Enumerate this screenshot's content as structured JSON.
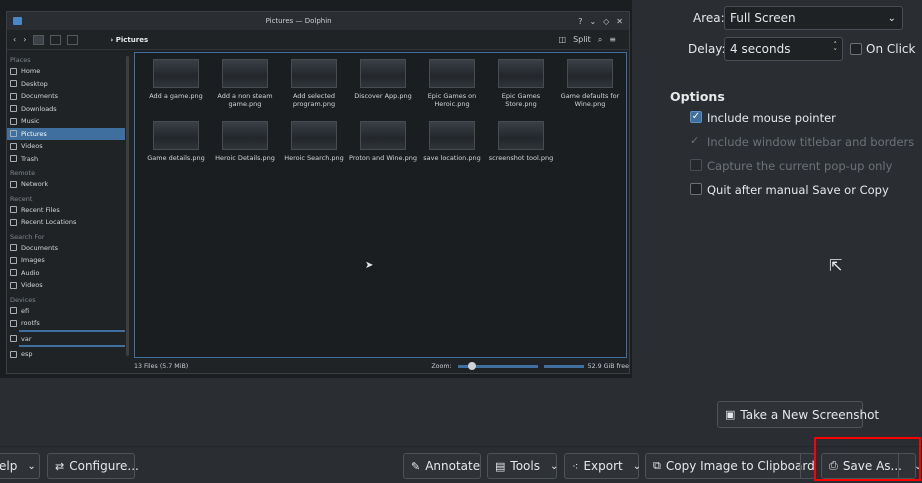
{
  "preview": {
    "dolphin": {
      "title": "Pictures — Dolphin",
      "breadcrumb": "Pictures",
      "split_label": "Split",
      "sidebar": [
        {
          "type": "section",
          "label": "Places"
        },
        {
          "type": "item",
          "label": "Home"
        },
        {
          "type": "item",
          "label": "Desktop"
        },
        {
          "type": "item",
          "label": "Documents"
        },
        {
          "type": "item",
          "label": "Downloads"
        },
        {
          "type": "item",
          "label": "Music"
        },
        {
          "type": "item",
          "label": "Pictures",
          "selected": true
        },
        {
          "type": "item",
          "label": "Videos"
        },
        {
          "type": "item",
          "label": "Trash"
        },
        {
          "type": "section",
          "label": "Remote"
        },
        {
          "type": "item",
          "label": "Network"
        },
        {
          "type": "section",
          "label": "Recent"
        },
        {
          "type": "item",
          "label": "Recent Files"
        },
        {
          "type": "item",
          "label": "Recent Locations"
        },
        {
          "type": "section",
          "label": "Search For"
        },
        {
          "type": "item",
          "label": "Documents"
        },
        {
          "type": "item",
          "label": "Images"
        },
        {
          "type": "item",
          "label": "Audio"
        },
        {
          "type": "item",
          "label": "Videos"
        },
        {
          "type": "section",
          "label": "Devices"
        },
        {
          "type": "item",
          "label": "efi"
        },
        {
          "type": "item",
          "label": "rootfs",
          "bar": true
        },
        {
          "type": "item",
          "label": "var",
          "bar": true
        },
        {
          "type": "item",
          "label": "esp"
        }
      ],
      "files": [
        "Add a game.png",
        "Add a non steam game.png",
        "Add selected program.png",
        "Discover App.png",
        "Epic Games on Heroic.png",
        "Epic Games Store.png",
        "Game defaults for Wine.png",
        "Game details.png",
        "Heroic Details.png",
        "Heroic Search.png",
        "Proton and Wine.png",
        "save location.png",
        "screenshot tool.png"
      ],
      "status_left": "13 Files (5.7 MiB)",
      "zoom_label": "Zoom:",
      "free_label": "52.9 GiB free"
    }
  },
  "settings": {
    "area_label": "Area:",
    "area_value": "Full Screen",
    "delay_label": "Delay:",
    "delay_value": "4 seconds",
    "on_click_label": "On Click",
    "options_title": "Options",
    "options": [
      {
        "label": "Include mouse pointer",
        "checked": true,
        "enabled": true
      },
      {
        "label": "Include window titlebar and borders",
        "checked": true,
        "enabled": false
      },
      {
        "label": "Capture the current pop-up only",
        "checked": false,
        "enabled": false
      },
      {
        "label": "Quit after manual Save or Copy",
        "checked": false,
        "enabled": true
      }
    ],
    "new_screenshot_label": "Take a New Screenshot"
  },
  "footer": {
    "help_label": "elp",
    "configure_label": "Configure...",
    "annotate_label": "Annotate",
    "tools_label": "Tools",
    "export_label": "Export",
    "copy_label": "Copy Image to Clipboard",
    "save_as_label": "Save As..."
  },
  "colors": {
    "accent": "#3e6f9e",
    "highlight_box": "#ff0000",
    "background": "#2a2e32"
  }
}
